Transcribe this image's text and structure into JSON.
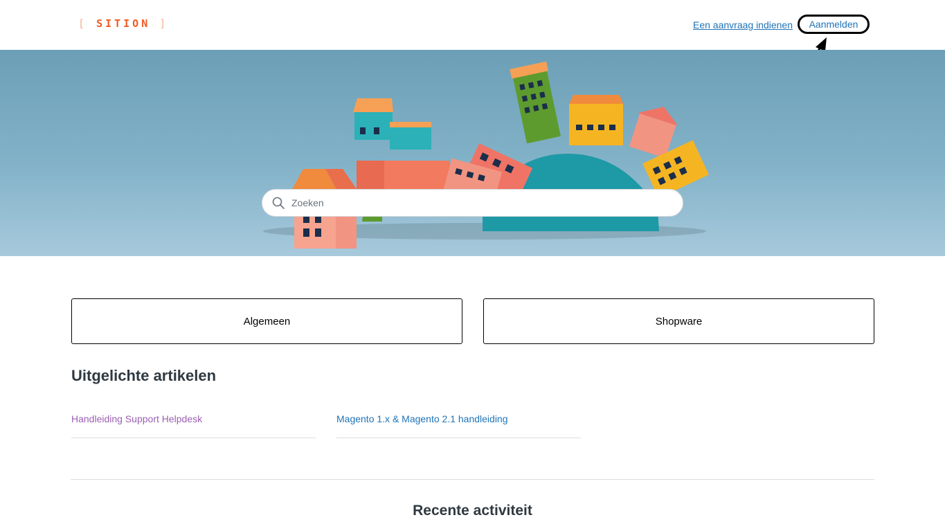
{
  "header": {
    "logo": "SITION",
    "request_link": "Een aanvraag indienen",
    "signin_button": "Aanmelden"
  },
  "search": {
    "placeholder": "Zoeken"
  },
  "categories": [
    {
      "label": "Algemeen"
    },
    {
      "label": "Shopware"
    }
  ],
  "promoted": {
    "title": "Uitgelichte artikelen",
    "articles": [
      {
        "label": "Handleiding Support Helpdesk",
        "color": "#9b5fb3"
      },
      {
        "label": "Magento 1.x & Magento 2.1 handleiding",
        "color": "#1f73b7"
      }
    ]
  },
  "recent": {
    "title": "Recente activiteit"
  },
  "colors": {
    "accent": "#f15a24",
    "link": "#1f73b7",
    "visited": "#9b5fb3"
  }
}
